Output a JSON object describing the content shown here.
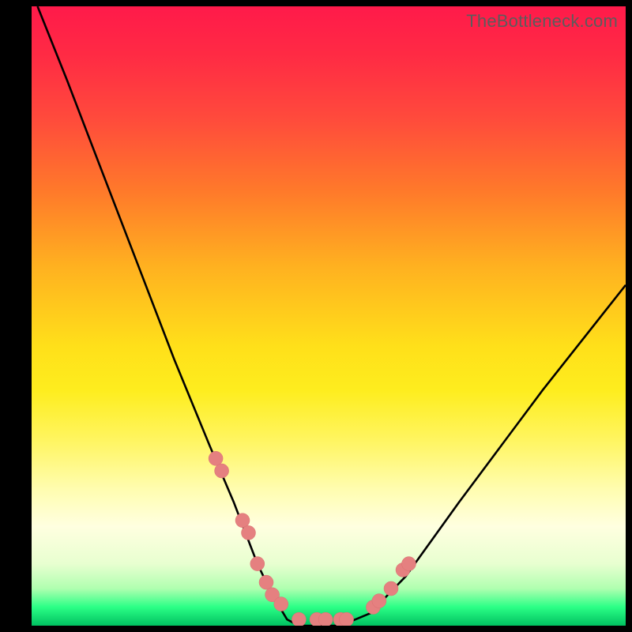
{
  "watermark": "TheBottleneck.com",
  "gradient_colors": {
    "top": "#ff1a4a",
    "upper_mid": "#ff7a2a",
    "mid": "#ffe01a",
    "lower_mid": "#fffdb0",
    "bottom": "#00c060"
  },
  "point_color": "#e58080",
  "curve_color": "#000000",
  "chart_data": {
    "type": "line",
    "title": "",
    "xlabel": "",
    "ylabel": "",
    "xlim": [
      0,
      100
    ],
    "ylim": [
      0,
      100
    ],
    "grid": false,
    "legend": null,
    "series": [
      {
        "name": "bottleneck-curve",
        "x": [
          1,
          6,
          12,
          18,
          24,
          30,
          34,
          36,
          38,
          40.5,
          43,
          45,
          47,
          52,
          57,
          63,
          72,
          86,
          100
        ],
        "y": [
          100,
          88,
          73,
          58,
          43,
          29,
          20,
          15,
          10,
          5,
          1,
          0,
          0,
          0,
          2,
          8,
          20,
          38,
          55
        ]
      },
      {
        "name": "data-points",
        "x": [
          31,
          32,
          35.5,
          36.5,
          38,
          39.5,
          40.5,
          42,
          45,
          48,
          49.5,
          52,
          53,
          57.5,
          58.5,
          60.5,
          62.5,
          63.5
        ],
        "y": [
          27,
          25,
          17,
          15,
          10,
          7,
          5,
          3.5,
          1,
          1,
          1,
          1,
          1,
          3,
          4,
          6,
          9,
          10
        ]
      }
    ]
  }
}
